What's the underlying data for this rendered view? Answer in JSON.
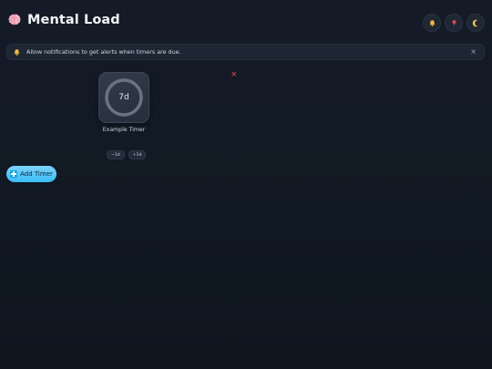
{
  "app": {
    "title": "Mental Load",
    "logo_icon": "brain-icon"
  },
  "header_actions": [
    {
      "icon": "bell-icon"
    },
    {
      "icon": "pin-icon"
    },
    {
      "icon": "moon-icon"
    }
  ],
  "notice": {
    "text": "Allow notifications to get alerts when timers are due.",
    "close": "×",
    "icon": "bell-icon"
  },
  "timers": [
    {
      "value": "7d",
      "name": "Example Timer",
      "delete": "×",
      "adjust_down": "−1d",
      "adjust_up": "+1d",
      "progress": 0.97
    }
  ],
  "add_button": {
    "label": "Add Timer",
    "icon": "plus-icon"
  },
  "colors": {
    "background": "#141b26",
    "accent": "#38bdf8",
    "danger": "#e5484d"
  }
}
